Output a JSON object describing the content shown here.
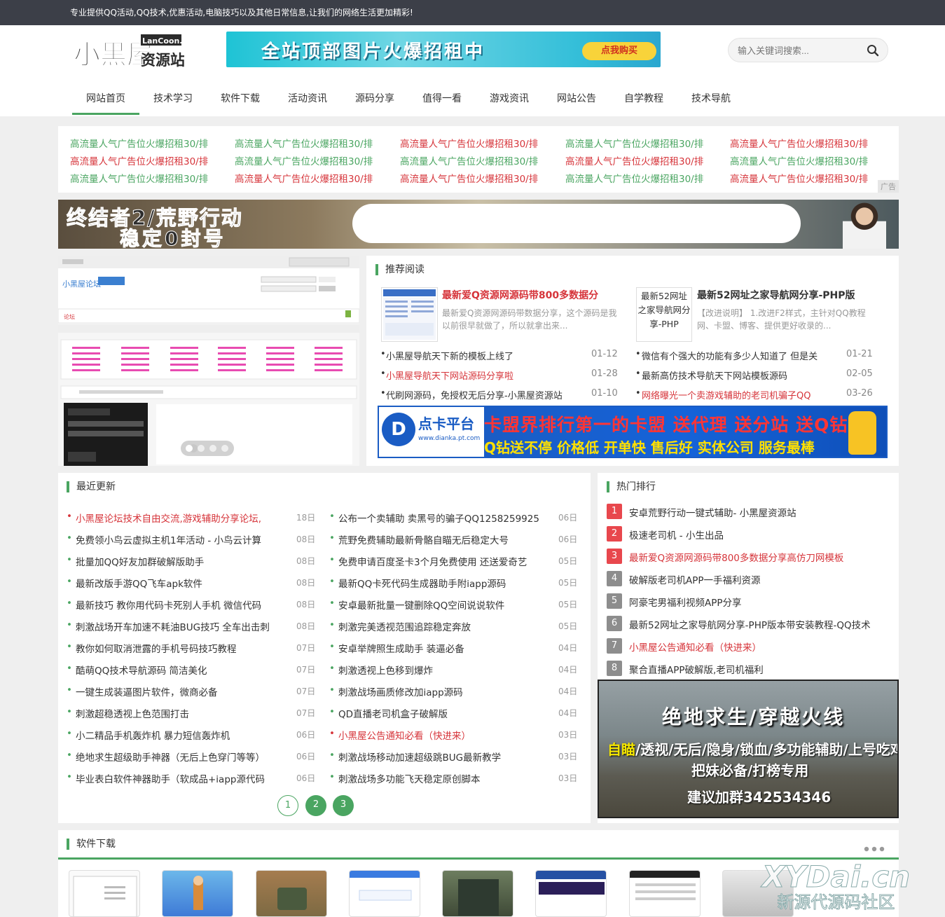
{
  "topbar": {
    "text": "专业提供QQ活动,QQ技术,优惠活动,电脑技巧以及其他日常信息,让我们的网络生活更加精彩!"
  },
  "logo": {
    "main": "小黑屋",
    "sub_top": "LanCoon.Cn",
    "sub_bottom": "资源站"
  },
  "banner_top": {
    "text": "全站顶部图片火爆招租中",
    "button": "点我购买"
  },
  "search": {
    "placeholder": "输入关键词搜索..."
  },
  "nav": [
    "网站首页",
    "技术学习",
    "软件下载",
    "活动资讯",
    "源码分享",
    "值得一看",
    "游戏资讯",
    "网站公告",
    "自学教程",
    "技术导航"
  ],
  "ad_links": {
    "text": "高流量人气广告位火爆招租30/排",
    "tag": "广告",
    "colors": [
      [
        "green",
        "green",
        "red",
        "green",
        "red"
      ],
      [
        "red",
        "green",
        "green",
        "red",
        "green"
      ],
      [
        "green",
        "red",
        "red",
        "green",
        "red"
      ]
    ]
  },
  "banner_game": {
    "line1": "终结者2/荒野行动",
    "line2": "稳定0封号"
  },
  "recommend": {
    "title": "推荐阅读",
    "feature1": {
      "title": "最新爱Q资源网源码带800多数据分",
      "desc": "最新爱Q资源网源码带数据分享，这个源码是我以前很早就做了，所以就拿出来..."
    },
    "feature2": {
      "title": "最新52网址之家导航网分享-PHP版",
      "img_alt": "最新52网址之家导航网分享-PHP",
      "desc": "【改进说明】 1.改进F2样式，主针对QQ教程网、卡盟、博客、提供更好收录的..."
    },
    "left_list": [
      {
        "text": "小黑屋导航天下新的模板上线了",
        "date": "01-12",
        "color": "normal"
      },
      {
        "text": "小黑屋导航天下网站源码分享啦",
        "date": "01-28",
        "color": "red"
      },
      {
        "text": "代刷网源码，免授权无后分享-小黑屋资源站",
        "date": "01-10",
        "color": "normal"
      }
    ],
    "right_list": [
      {
        "text": "微信有个强大的功能有多少人知道了 但是关",
        "date": "01-21",
        "color": "normal"
      },
      {
        "text": "最新高仿技术导航天下网站模板源码",
        "date": "02-05",
        "color": "normal"
      },
      {
        "text": "网络曝光一个卖游戏辅助的老司机骗子QQ",
        "date": "03-26",
        "color": "red"
      }
    ]
  },
  "banner_card": {
    "brand": "点卡平台",
    "url": "www.dianka.pt.com",
    "line1": "卡盟界排行第一的卡盟 送代理 送分站 送Q钻",
    "line2": "Q钻送不停 价格低 开单快 售后好 实体公司 服务最棒"
  },
  "latest": {
    "title": "最近更新",
    "left": [
      {
        "text": "小黑屋论坛技术自由交流,游戏辅助分享论坛,",
        "date": "18日",
        "color": "red"
      },
      {
        "text": "免费领小鸟云虚拟主机1年活动 - 小鸟云计算",
        "date": "08日",
        "color": "normal"
      },
      {
        "text": "批量加QQ好友加群破解版助手",
        "date": "08日",
        "color": "normal"
      },
      {
        "text": "最新改版手游QQ飞车apk软件",
        "date": "08日",
        "color": "normal"
      },
      {
        "text": "最新技巧 教你用代码卡死别人手机 微信代码",
        "date": "08日",
        "color": "normal"
      },
      {
        "text": "刺激战场开车加速不耗油BUG技巧 全车出击刺",
        "date": "08日",
        "color": "normal"
      },
      {
        "text": "教你如何取消泄露的手机号码技巧教程",
        "date": "07日",
        "color": "normal"
      },
      {
        "text": "酷萌QQ技术导航源码 简洁美化",
        "date": "07日",
        "color": "normal"
      },
      {
        "text": "一键生成装逼图片软件，微商必备",
        "date": "07日",
        "color": "normal"
      },
      {
        "text": "刺激超稳透视上色范围打击",
        "date": "07日",
        "color": "normal"
      },
      {
        "text": "小二精品手机轰炸机 暴力短信轰炸机",
        "date": "06日",
        "color": "normal"
      },
      {
        "text": "绝地求生超级助手神器（无后上色穿门等等）",
        "date": "06日",
        "color": "normal"
      },
      {
        "text": "毕业表白软件神器助手（软成品+iapp源代码",
        "date": "06日",
        "color": "normal"
      }
    ],
    "right": [
      {
        "text": "公布一个卖辅助 卖黑号的骗子QQ1258259925",
        "date": "06日",
        "color": "normal"
      },
      {
        "text": "荒野免费辅助最新骨骼自瞄无后稳定大号",
        "date": "06日",
        "color": "normal"
      },
      {
        "text": "免费申请百度圣卡3个月免费使用 还送爱奇艺",
        "date": "05日",
        "color": "normal"
      },
      {
        "text": "最新QQ卡死代码生成器助手附iapp源码",
        "date": "05日",
        "color": "normal"
      },
      {
        "text": "安卓最新批量一键删除QQ空间说说软件",
        "date": "05日",
        "color": "normal"
      },
      {
        "text": "刺激完美透视范围追踪稳定奔放",
        "date": "05日",
        "color": "normal"
      },
      {
        "text": "安卓举牌照生成助手 装逼必备",
        "date": "04日",
        "color": "normal"
      },
      {
        "text": "刺激透视上色移到爆炸",
        "date": "04日",
        "color": "normal"
      },
      {
        "text": "刺激战场画质修改加iapp源码",
        "date": "04日",
        "color": "normal"
      },
      {
        "text": "QD直播老司机盒子破解版",
        "date": "04日",
        "color": "normal"
      },
      {
        "text": "小黑屋公告通知必看（快进来）",
        "date": "03日",
        "color": "red"
      },
      {
        "text": "刺激战场移动加速超级跳BUG最新教学",
        "date": "03日",
        "color": "normal"
      },
      {
        "text": "刺激战场多功能飞天稳定原创脚本",
        "date": "03日",
        "color": "normal"
      }
    ],
    "pages": [
      "1",
      "2",
      "3"
    ]
  },
  "hot": {
    "title": "热门排行",
    "items": [
      {
        "rank": "1",
        "text": "安卓荒野行动一键式辅助- 小黑屋资源站",
        "color": "normal",
        "badge": "#e8474d"
      },
      {
        "rank": "2",
        "text": "极速老司机 - 小生出品",
        "color": "normal",
        "badge": "#e8474d"
      },
      {
        "rank": "3",
        "text": "最新爱Q资源网源码带800多数据分享高仿刀网模板",
        "color": "red",
        "badge": "#e8474d"
      },
      {
        "rank": "4",
        "text": "破解版老司机APP一手福利资源",
        "color": "normal",
        "badge": "#8d8d8d"
      },
      {
        "rank": "5",
        "text": "阿豪宅男福利视频APP分享",
        "color": "normal",
        "badge": "#8d8d8d"
      },
      {
        "rank": "6",
        "text": "最新52网址之家导航网分享-PHP版本带安装教程-QQ技术",
        "color": "normal",
        "badge": "#8d8d8d"
      },
      {
        "rank": "7",
        "text": "小黑屋公告通知必看（快进来）",
        "color": "red",
        "badge": "#8d8d8d"
      },
      {
        "rank": "8",
        "text": "聚合直播APP破解版,老司机福利",
        "color": "normal",
        "badge": "#8d8d8d"
      }
    ]
  },
  "banner_pubg": {
    "line1": "绝地求生/穿越火线",
    "line2_a": "自瞄",
    "line2_b": "/透视/无后/隐身/锁血/多功能辅助/上号吃鸡",
    "line3": "把妹必备/打榜专用",
    "line4": "建议加群342534346"
  },
  "software": {
    "title": "软件下载"
  },
  "watermark": {
    "line1": "XYDai.cn",
    "line2": "新源代源码社区"
  },
  "colors": {
    "accent": "#4aa561",
    "red": "#d6343a",
    "topbar": "#3c3f48"
  }
}
